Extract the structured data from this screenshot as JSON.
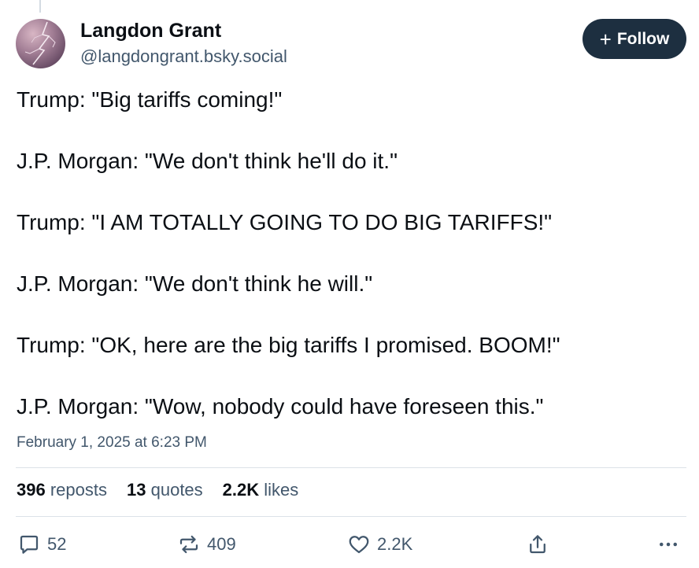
{
  "author": {
    "name": "Langdon Grant",
    "handle": "@langdongrant.bsky.social",
    "avatar_icon": "lightning-storm-avatar"
  },
  "follow_button": {
    "icon": "+",
    "label": "Follow"
  },
  "post": {
    "lines": [
      "Trump: \"Big tariffs coming!\"",
      "J.P. Morgan: \"We don't think he'll do it.\"",
      "Trump: \"I AM TOTALLY GOING TO DO BIG TARIFFS!\"",
      "J.P. Morgan: \"We don't think he will.\"",
      "Trump: \"OK, here are the big tariffs I promised.  BOOM!\"",
      "J.P. Morgan: \"Wow, nobody could have foreseen this.\""
    ],
    "timestamp": "February 1, 2025 at 6:23 PM"
  },
  "stats": {
    "reposts": {
      "count": "396",
      "label": "reposts"
    },
    "quotes": {
      "count": "13",
      "label": "quotes"
    },
    "likes": {
      "count": "2.2K",
      "label": "likes"
    }
  },
  "actions": {
    "reply": {
      "icon": "reply-icon",
      "count": "52"
    },
    "repost": {
      "icon": "repost-icon",
      "count": "409"
    },
    "like": {
      "icon": "heart-icon",
      "count": "2.2K"
    },
    "share": {
      "icon": "share-icon"
    },
    "more": {
      "icon": "more-icon"
    }
  },
  "colors": {
    "text": "#0b0f14",
    "muted": "#42576c",
    "follow_bg": "#1d2f40",
    "divider": "#dce2e8"
  }
}
